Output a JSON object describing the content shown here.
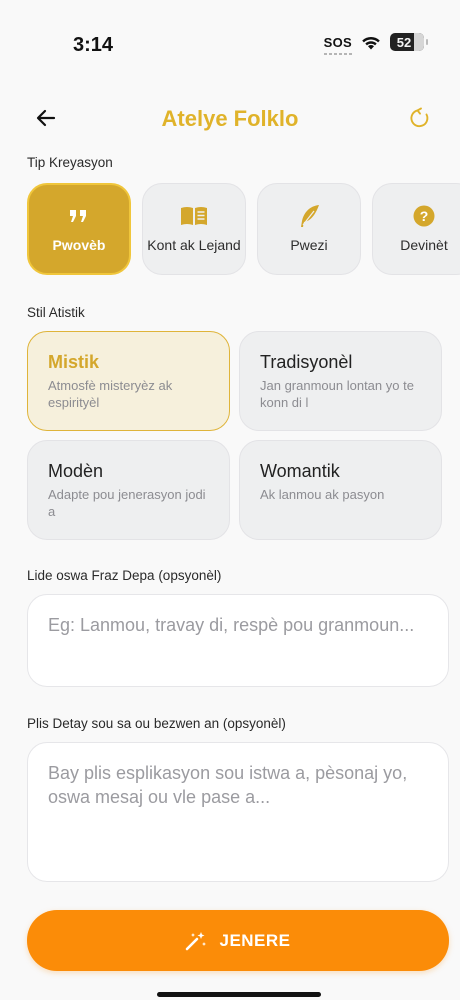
{
  "status_bar": {
    "time": "3:14",
    "sos": "SOS",
    "battery": "52"
  },
  "header": {
    "title": "Atelye Folklo",
    "back_icon": "arrow-left-icon",
    "refresh_icon": "refresh-icon"
  },
  "creation_type": {
    "label": "Tip Kreyasyon",
    "items": [
      {
        "label": "Pwovèb",
        "icon": "quote-icon",
        "selected": true
      },
      {
        "label": "Kont ak Lejand",
        "icon": "book-icon",
        "selected": false
      },
      {
        "label": "Pwezi",
        "icon": "feather-icon",
        "selected": false
      },
      {
        "label": "Devinèt",
        "icon": "question-circle-icon",
        "selected": false
      }
    ]
  },
  "artistic_style": {
    "label": "Stil Atistik",
    "items": [
      {
        "title": "Mistik",
        "desc": "Atmosfè misteryèz ak espirityèl",
        "selected": true
      },
      {
        "title": "Tradisyonèl",
        "desc": "Jan granmoun lontan yo te konn di l",
        "selected": false
      },
      {
        "title": "Modèn",
        "desc": "Adapte pou jenerasyon jodi a",
        "selected": false
      },
      {
        "title": "Womantik",
        "desc": "Ak lanmou ak pasyon",
        "selected": false
      }
    ]
  },
  "idea": {
    "label": "Lide oswa Fraz Depa (opsyonèl)",
    "placeholder": "Eg: Lanmou, travay di, respè pou granmoun..."
  },
  "details": {
    "label": "Plis Detay sou sa ou bezwen an (opsyonèl)",
    "placeholder": "Bay plis esplikasyon sou istwa a, pèsonaj yo, oswa mesaj ou vle pase a..."
  },
  "generate": {
    "label": "JENERE",
    "icon": "magic-wand-icon"
  },
  "colors": {
    "accent": "#d4a72c",
    "title": "#e0b32a",
    "button": "#fb8c08"
  }
}
